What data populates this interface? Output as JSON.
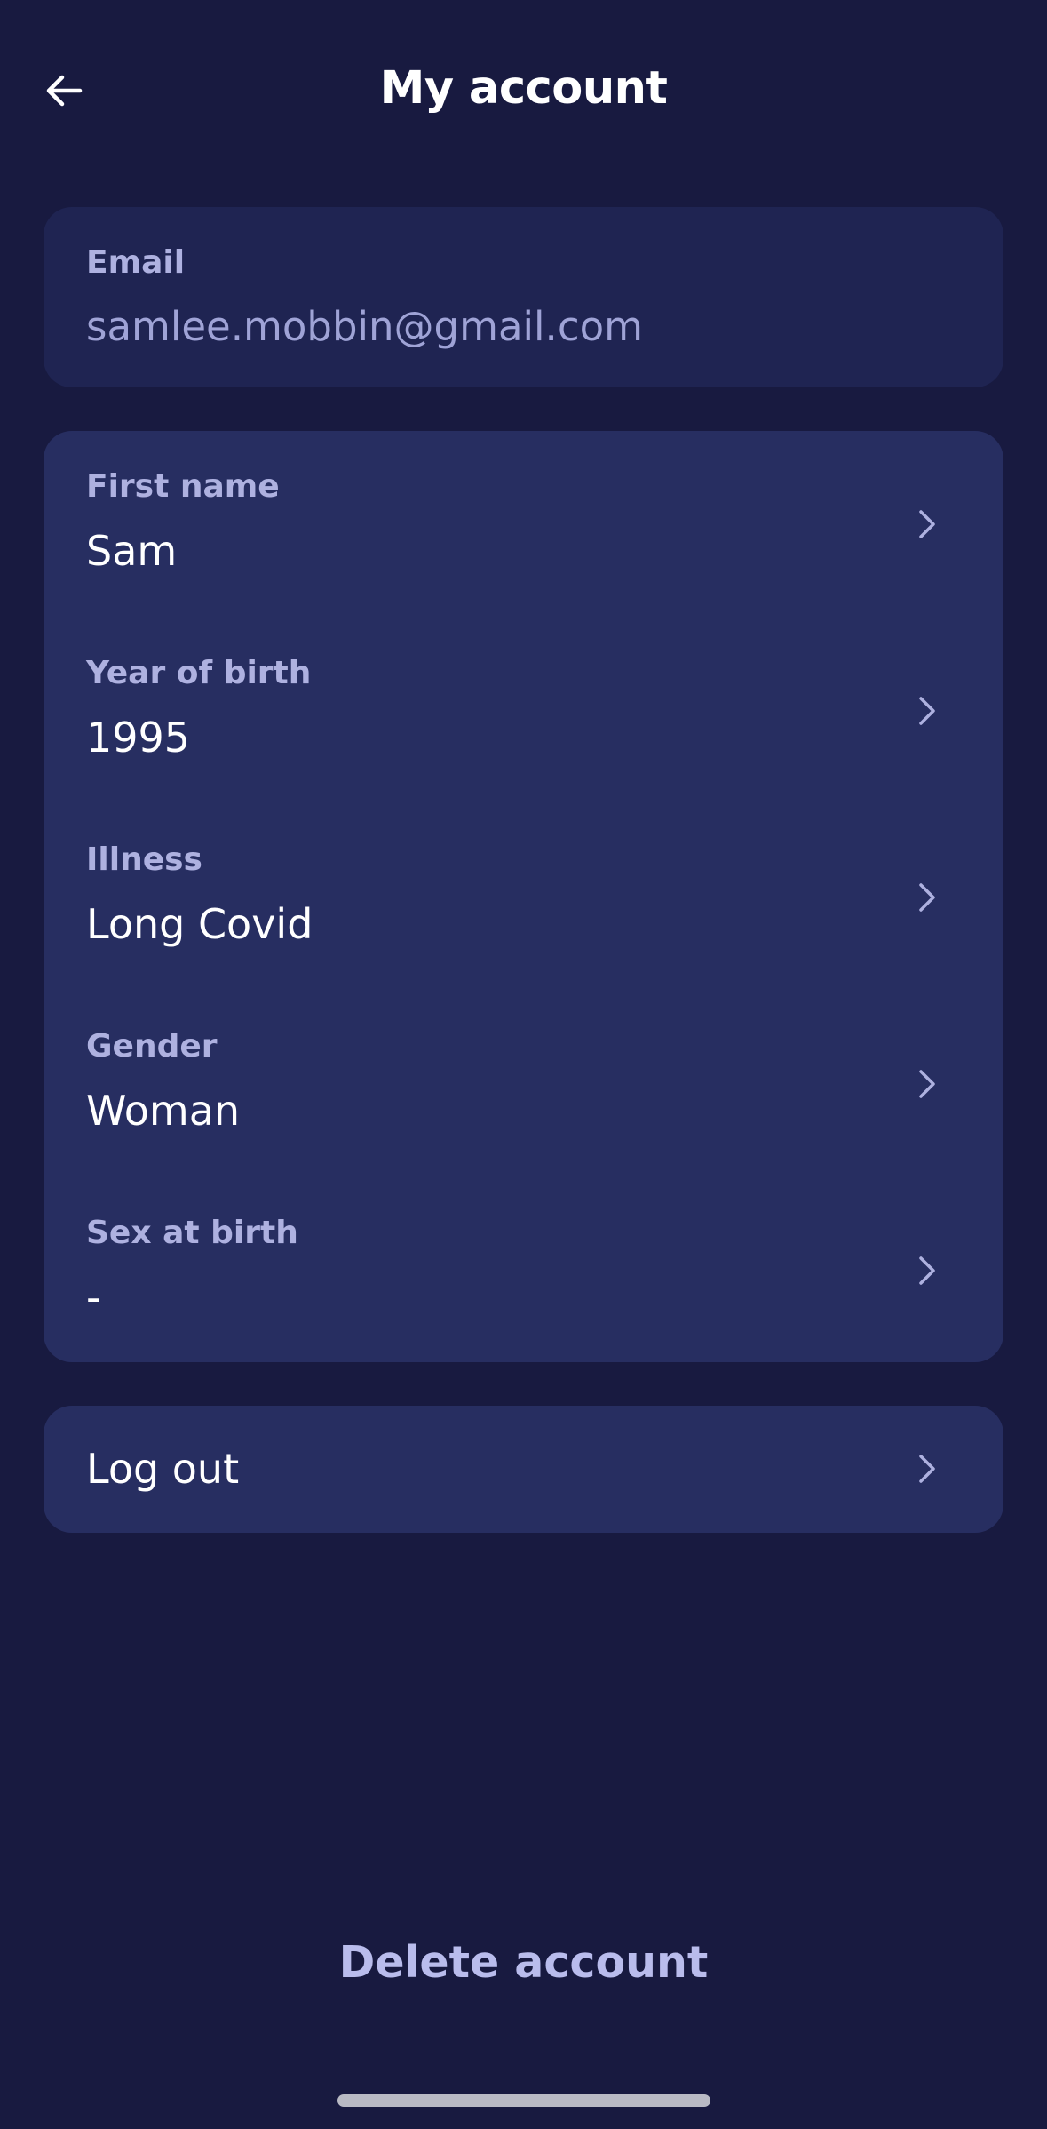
{
  "header": {
    "title": "My account",
    "back_icon": "arrow-left-icon"
  },
  "email": {
    "label": "Email",
    "value": "samlee.mobbin@gmail.com"
  },
  "profile": {
    "rows": [
      {
        "label": "First name",
        "value": "Sam"
      },
      {
        "label": "Year of birth",
        "value": "1995"
      },
      {
        "label": "Illness",
        "value": "Long Covid"
      },
      {
        "label": "Gender",
        "value": "Woman"
      },
      {
        "label": "Sex at birth",
        "value": "-"
      }
    ],
    "chevron_icon": "chevron-right-icon"
  },
  "logout": {
    "label": "Log out"
  },
  "delete": {
    "label": "Delete account"
  },
  "colors": {
    "background": "#181a40",
    "email_card": "#1f2452",
    "card": "#272e61",
    "label": "#aeb1e0",
    "muted_value": "#9fa3d6",
    "text": "#ffffff",
    "delete": "#b9bcec"
  }
}
